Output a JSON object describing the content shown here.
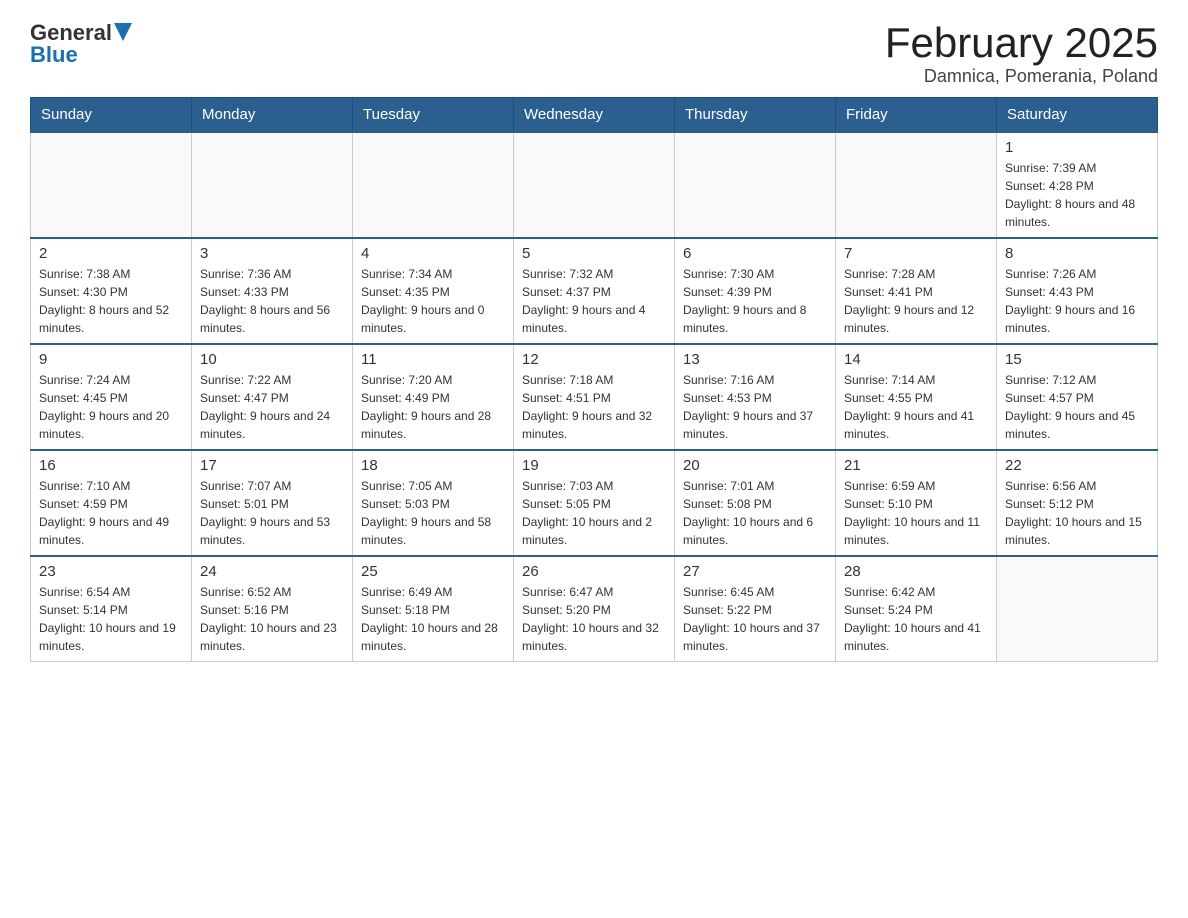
{
  "header": {
    "logo_general": "General",
    "logo_blue": "Blue",
    "month_title": "February 2025",
    "location": "Damnica, Pomerania, Poland"
  },
  "days_of_week": [
    "Sunday",
    "Monday",
    "Tuesday",
    "Wednesday",
    "Thursday",
    "Friday",
    "Saturday"
  ],
  "weeks": [
    {
      "days": [
        {
          "number": "",
          "info": ""
        },
        {
          "number": "",
          "info": ""
        },
        {
          "number": "",
          "info": ""
        },
        {
          "number": "",
          "info": ""
        },
        {
          "number": "",
          "info": ""
        },
        {
          "number": "",
          "info": ""
        },
        {
          "number": "1",
          "info": "Sunrise: 7:39 AM\nSunset: 4:28 PM\nDaylight: 8 hours and 48 minutes."
        }
      ]
    },
    {
      "days": [
        {
          "number": "2",
          "info": "Sunrise: 7:38 AM\nSunset: 4:30 PM\nDaylight: 8 hours and 52 minutes."
        },
        {
          "number": "3",
          "info": "Sunrise: 7:36 AM\nSunset: 4:33 PM\nDaylight: 8 hours and 56 minutes."
        },
        {
          "number": "4",
          "info": "Sunrise: 7:34 AM\nSunset: 4:35 PM\nDaylight: 9 hours and 0 minutes."
        },
        {
          "number": "5",
          "info": "Sunrise: 7:32 AM\nSunset: 4:37 PM\nDaylight: 9 hours and 4 minutes."
        },
        {
          "number": "6",
          "info": "Sunrise: 7:30 AM\nSunset: 4:39 PM\nDaylight: 9 hours and 8 minutes."
        },
        {
          "number": "7",
          "info": "Sunrise: 7:28 AM\nSunset: 4:41 PM\nDaylight: 9 hours and 12 minutes."
        },
        {
          "number": "8",
          "info": "Sunrise: 7:26 AM\nSunset: 4:43 PM\nDaylight: 9 hours and 16 minutes."
        }
      ]
    },
    {
      "days": [
        {
          "number": "9",
          "info": "Sunrise: 7:24 AM\nSunset: 4:45 PM\nDaylight: 9 hours and 20 minutes."
        },
        {
          "number": "10",
          "info": "Sunrise: 7:22 AM\nSunset: 4:47 PM\nDaylight: 9 hours and 24 minutes."
        },
        {
          "number": "11",
          "info": "Sunrise: 7:20 AM\nSunset: 4:49 PM\nDaylight: 9 hours and 28 minutes."
        },
        {
          "number": "12",
          "info": "Sunrise: 7:18 AM\nSunset: 4:51 PM\nDaylight: 9 hours and 32 minutes."
        },
        {
          "number": "13",
          "info": "Sunrise: 7:16 AM\nSunset: 4:53 PM\nDaylight: 9 hours and 37 minutes."
        },
        {
          "number": "14",
          "info": "Sunrise: 7:14 AM\nSunset: 4:55 PM\nDaylight: 9 hours and 41 minutes."
        },
        {
          "number": "15",
          "info": "Sunrise: 7:12 AM\nSunset: 4:57 PM\nDaylight: 9 hours and 45 minutes."
        }
      ]
    },
    {
      "days": [
        {
          "number": "16",
          "info": "Sunrise: 7:10 AM\nSunset: 4:59 PM\nDaylight: 9 hours and 49 minutes."
        },
        {
          "number": "17",
          "info": "Sunrise: 7:07 AM\nSunset: 5:01 PM\nDaylight: 9 hours and 53 minutes."
        },
        {
          "number": "18",
          "info": "Sunrise: 7:05 AM\nSunset: 5:03 PM\nDaylight: 9 hours and 58 minutes."
        },
        {
          "number": "19",
          "info": "Sunrise: 7:03 AM\nSunset: 5:05 PM\nDaylight: 10 hours and 2 minutes."
        },
        {
          "number": "20",
          "info": "Sunrise: 7:01 AM\nSunset: 5:08 PM\nDaylight: 10 hours and 6 minutes."
        },
        {
          "number": "21",
          "info": "Sunrise: 6:59 AM\nSunset: 5:10 PM\nDaylight: 10 hours and 11 minutes."
        },
        {
          "number": "22",
          "info": "Sunrise: 6:56 AM\nSunset: 5:12 PM\nDaylight: 10 hours and 15 minutes."
        }
      ]
    },
    {
      "days": [
        {
          "number": "23",
          "info": "Sunrise: 6:54 AM\nSunset: 5:14 PM\nDaylight: 10 hours and 19 minutes."
        },
        {
          "number": "24",
          "info": "Sunrise: 6:52 AM\nSunset: 5:16 PM\nDaylight: 10 hours and 23 minutes."
        },
        {
          "number": "25",
          "info": "Sunrise: 6:49 AM\nSunset: 5:18 PM\nDaylight: 10 hours and 28 minutes."
        },
        {
          "number": "26",
          "info": "Sunrise: 6:47 AM\nSunset: 5:20 PM\nDaylight: 10 hours and 32 minutes."
        },
        {
          "number": "27",
          "info": "Sunrise: 6:45 AM\nSunset: 5:22 PM\nDaylight: 10 hours and 37 minutes."
        },
        {
          "number": "28",
          "info": "Sunrise: 6:42 AM\nSunset: 5:24 PM\nDaylight: 10 hours and 41 minutes."
        },
        {
          "number": "",
          "info": ""
        }
      ]
    }
  ]
}
